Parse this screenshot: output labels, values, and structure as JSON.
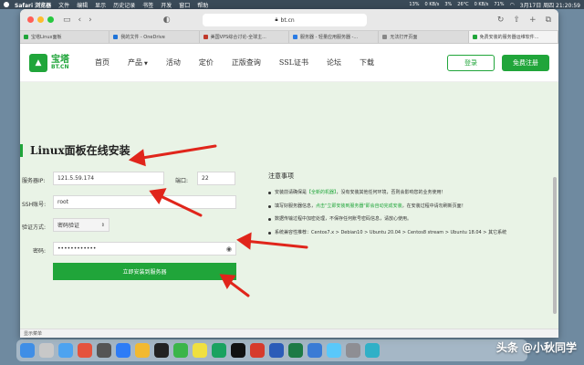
{
  "menubar": {
    "app_name": "Safari 浏览器",
    "items": [
      "文件",
      "编辑",
      "显示",
      "历史记录",
      "书签",
      "开发",
      "窗口",
      "帮助"
    ],
    "status": [
      "13%",
      "0 KB/s",
      "3%",
      "26°C",
      "0 KB/s",
      "71%"
    ],
    "datetime": "3月17日 周四 21:20:59"
  },
  "browser": {
    "address": "bt.cn",
    "tabs": [
      "宝塔Linux面板",
      "我的文件 - OneDrive",
      "美国VPS综合讨论-全球主...",
      "服务器 - 轻量应用服务器 -...",
      "无法打开页面",
      "免费安装的服务器运维软件..."
    ]
  },
  "site": {
    "logo_cn": "宝塔",
    "logo_en": "BT.CN",
    "nav": [
      "首页",
      "产品",
      "活动",
      "定价",
      "正版查询",
      "SSL证书",
      "论坛",
      "下载"
    ],
    "login": "登录",
    "register": "免费注册"
  },
  "form": {
    "heading": "Linux面板在线安装",
    "ip_label": "服务器IP:",
    "ip_value": "121.5.59.174",
    "port_label": "端口:",
    "port_value": "22",
    "ssh_label": "SSH账号:",
    "ssh_value": "root",
    "auth_label": "验证方式:",
    "auth_value": "密码验证",
    "pwd_label": "密码:",
    "pwd_value": "••••••••••••",
    "submit": "立即安装到服务器"
  },
  "notes": {
    "title": "注意事项",
    "items": [
      {
        "pre": "安装前请确保是",
        "hl": "【全新的机器】",
        "post": "，没有安装其他任何环境，否则会影响您的业务使用！"
      },
      {
        "pre": "填写好服务器信息，",
        "hl": "点击\"立即安装到服务器\"即会自动完成安装",
        "post": "，在安装过程中请勿刷新页面！"
      },
      {
        "pre": "数据传输过程中加密处理，不保存任何账号密码信息，请放心使用。",
        "hl": "",
        "post": ""
      },
      {
        "pre": "系统兼容性推荐：Centos7.x > Debian10 > Ubuntu 20.04 > Centos8 stream > Ubuntu 18.04 > 其它系统",
        "hl": "",
        "post": ""
      }
    ]
  },
  "statusbar": "显示菜单",
  "watermark": "头条 @小秋同学",
  "colors": {
    "brand": "#20a53a",
    "arrow": "#e0251b",
    "bg": "#e9f3e6"
  }
}
